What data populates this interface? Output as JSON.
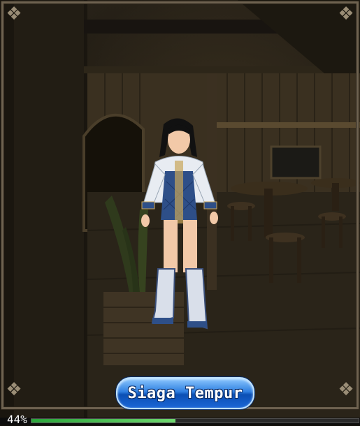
{
  "scene": {
    "action_button": {
      "label": "Siaga Tempur"
    },
    "loading": {
      "percent_text": "44%",
      "fraction": 0.44
    }
  }
}
